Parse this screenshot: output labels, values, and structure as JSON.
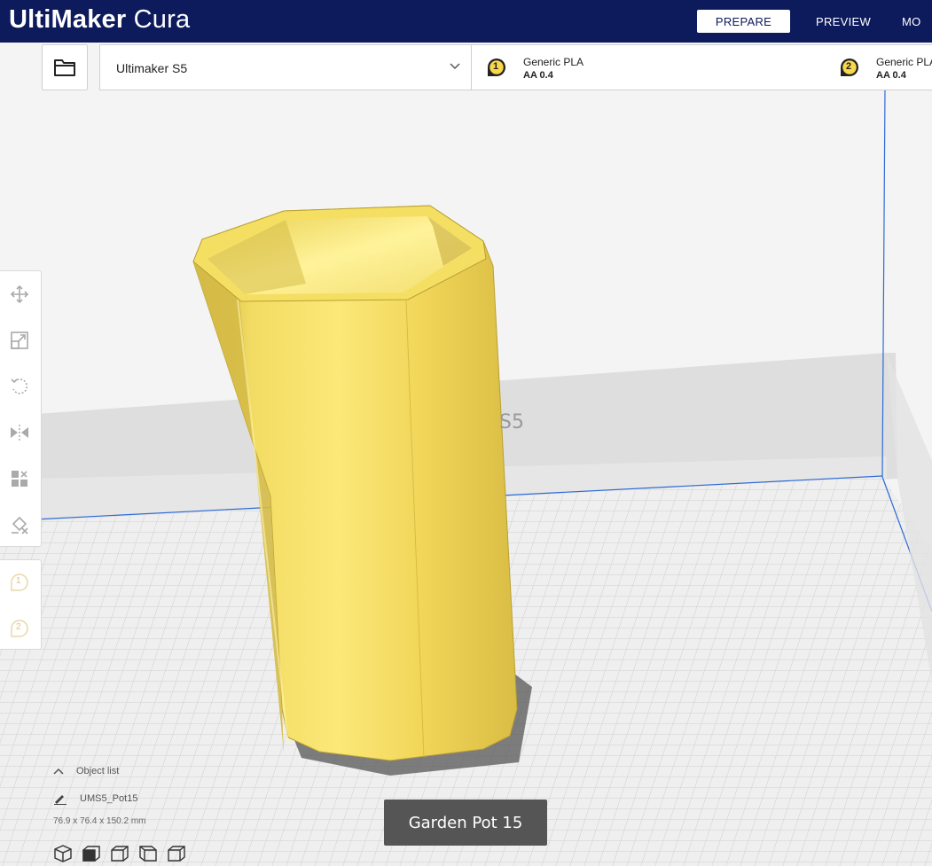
{
  "app": {
    "logo_brand": "UltiMaker",
    "logo_product": "Cura"
  },
  "stages": [
    {
      "label": "PREPARE",
      "active": true
    },
    {
      "label": "PREVIEW",
      "active": false
    },
    {
      "label": "MO",
      "active": false
    }
  ],
  "printer": {
    "name": "Ultimaker S5"
  },
  "extruders": [
    {
      "number": "1",
      "material": "Generic PLA",
      "core": "AA 0.4",
      "color": "#f8d84a"
    },
    {
      "number": "2",
      "material": "Generic PLA",
      "core": "AA 0.4",
      "color": "#f8d84a"
    }
  ],
  "viewport": {
    "plate_label": "S5",
    "model_color": "#f7e26a"
  },
  "extruder_panel": [
    "1",
    "2"
  ],
  "object_list": {
    "toggle_label": "Object list",
    "object_name": "UMS5_Pot15",
    "dimensions": "76.9 x 76.4 x 150.2 mm"
  },
  "tooltip": "Garden Pot 15",
  "colors": {
    "header": "#0d1a5c",
    "accent": "#1a6adc"
  }
}
